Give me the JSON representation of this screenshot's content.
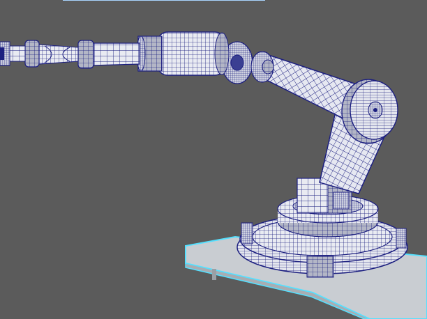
{
  "viewport": {
    "background": "#5b5b5b",
    "wire_color": "#1c1f80",
    "surface_light": "#eef0f4",
    "surface_shade": "#b9bccb",
    "platform_fill": "#c9cdd2",
    "platform_outline": "#55e0ff"
  },
  "scene": {
    "icons": {
      "model": "robot-arm-wireframe",
      "ground": "platform-plane"
    }
  }
}
